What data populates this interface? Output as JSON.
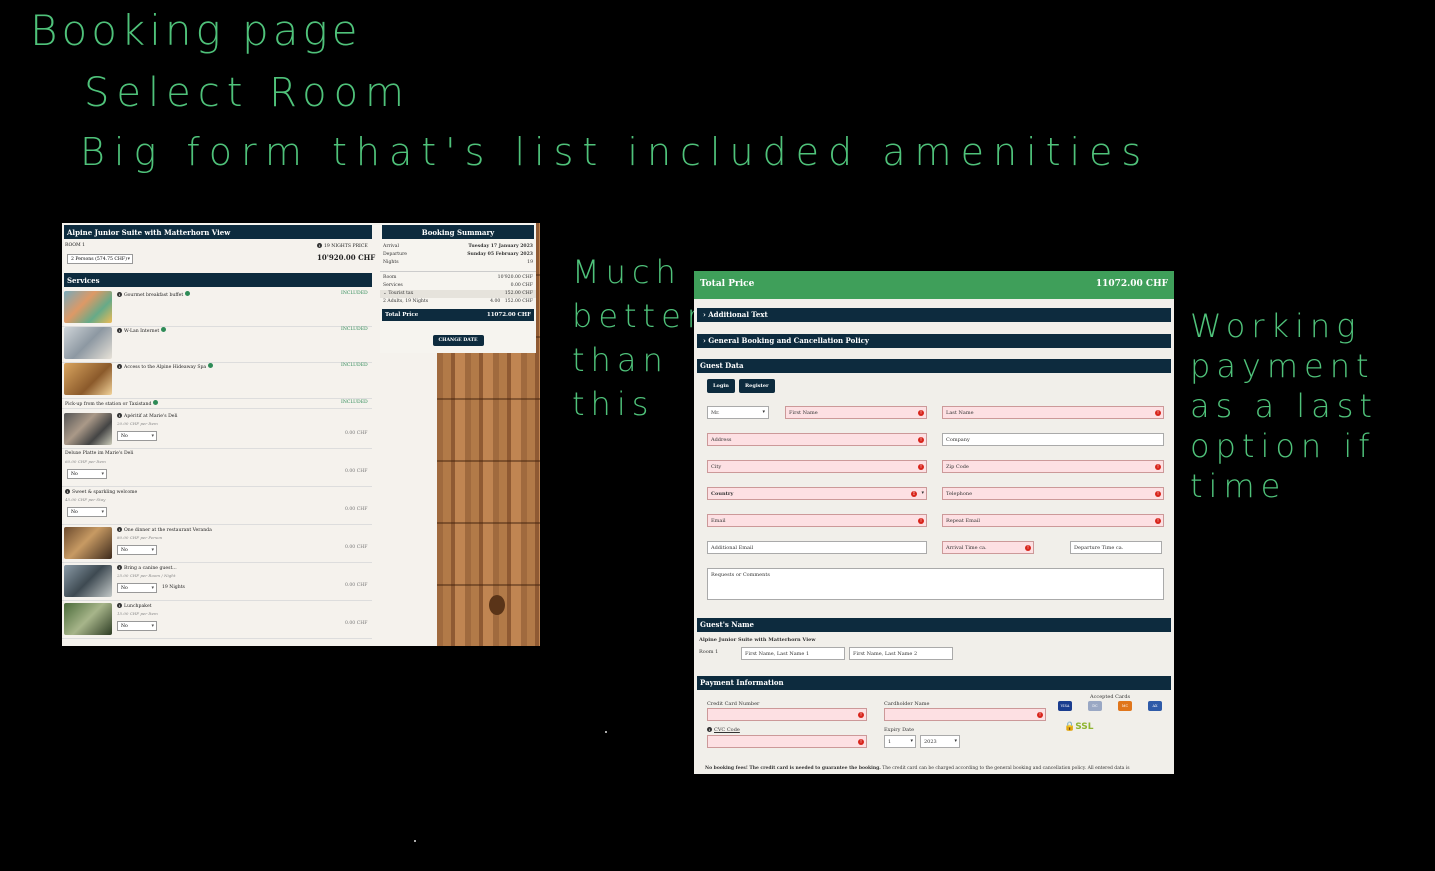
{
  "notes": {
    "title": "Booking page",
    "step": "Select Room",
    "form": "Big form that's list included amenities",
    "better": "Much better than this",
    "payment": "Working payment as a last option if time"
  },
  "left": {
    "room_title": "Alpine Junior Suite with Matterhorn View",
    "room_label": "ROOM 1",
    "persons_select": "2 Persons (574.75 CHF)",
    "nights_price_label": "19 NIGHTS PRICE",
    "room_price": "10'920.00 CHF",
    "services_heading": "Services",
    "services": [
      {
        "name": "Gourmet breakfast buffet",
        "status": "INCLUDED",
        "sub": "",
        "select": ""
      },
      {
        "name": "W-Lan Internet",
        "status": "INCLUDED",
        "sub": "",
        "select": ""
      },
      {
        "name": "Access to the Alpine Hideaway Spa",
        "status": "INCLUDED",
        "sub": "",
        "select": ""
      },
      {
        "name": "Apéritif at Marie's Deli",
        "status": "0.00 CHF",
        "sub": "20.00 CHF per Item",
        "select": "No"
      },
      {
        "name": "Deluxe Platte im Marie's Deli",
        "status": "0.00 CHF",
        "sub": "60.00 CHF per Item",
        "select": "No"
      },
      {
        "name": "Sweet & sparkling welcome",
        "status": "0.00 CHF",
        "sub": "45.00 CHF per Stay",
        "select": "No"
      },
      {
        "name": "One dinner at the restaurant Veranda",
        "status": "0.00 CHF",
        "sub": "80.00 CHF per Person",
        "select": "No"
      },
      {
        "name": "Bring a canine guest...",
        "status": "0.00 CHF",
        "sub": "25.00 CHF per Room / Night",
        "select": "No"
      },
      {
        "name": "Lunchpaket",
        "status": "0.00 CHF",
        "sub": "15.00 CHF per Item",
        "select": "No"
      }
    ],
    "pickup": {
      "name": "Pick-up from the station or Taxistand",
      "status": "INCLUDED"
    },
    "dog_nights": "19 Nights",
    "summary": {
      "heading": "Booking Summary",
      "rows": [
        {
          "label": "Arrival",
          "value": "Tuesday 17 January 2023"
        },
        {
          "label": "Departure",
          "value": "Sunday 05 February 2023"
        },
        {
          "label": "Nights",
          "value": "19"
        },
        {
          "label": "Room",
          "value": "10'920.00 CHF"
        },
        {
          "label": "Services",
          "value": "0.00 CHF"
        },
        {
          "label": "Tourist tax",
          "value": "152.00 CHF"
        }
      ],
      "tax_detail_label": "2 Adults, 19 Nights",
      "tax_detail_rate": "4.00",
      "tax_detail_value": "152.00 CHF",
      "total_label": "Total Price",
      "total_value": "11072.00 CHF",
      "button": "CHANGE DATE"
    }
  },
  "right": {
    "total_label": "Total Price",
    "total_value": "11072.00 CHF",
    "accordion": [
      "Additional Text",
      "General Booking and Cancellation Policy"
    ],
    "guest_heading": "Guest Data",
    "login": "Login",
    "register": "Register",
    "salutation": "Mr.",
    "fields": {
      "first_name": "First Name",
      "last_name": "Last Name",
      "address": "Address",
      "company": "Company",
      "city": "City",
      "zip": "Zip Code",
      "country": "Country",
      "telephone": "Telephone",
      "email": "Email",
      "repeat_email": "Repeat Email",
      "additional_email": "Additional Email",
      "arrival_time": "Arrival Time ca.",
      "departure_time": "Departure Time ca.",
      "requests": "Requests or Comments"
    },
    "guests_heading": "Guest's Name",
    "guests_room": "Alpine Junior Suite with Matterhorn View",
    "guests_room_label": "Room 1",
    "guest1": "First Name, Last Name 1",
    "guest2": "First Name, Last Name 2",
    "payment_heading": "Payment Information",
    "cc_number": "Credit Card Number",
    "cardholder": "Cardholder Name",
    "cvc": "CVC Code",
    "expiry": "Expiry Date",
    "expiry_month": "1",
    "expiry_year": "2023",
    "accepted_cards": "Accepted Cards",
    "ssl": "SSL",
    "fine_bold": "No booking fees! The credit card is needed to guarantee the booking.",
    "fine_rest": "The credit card can be charged according to the general booking and cancellation policy. All entered data is"
  }
}
